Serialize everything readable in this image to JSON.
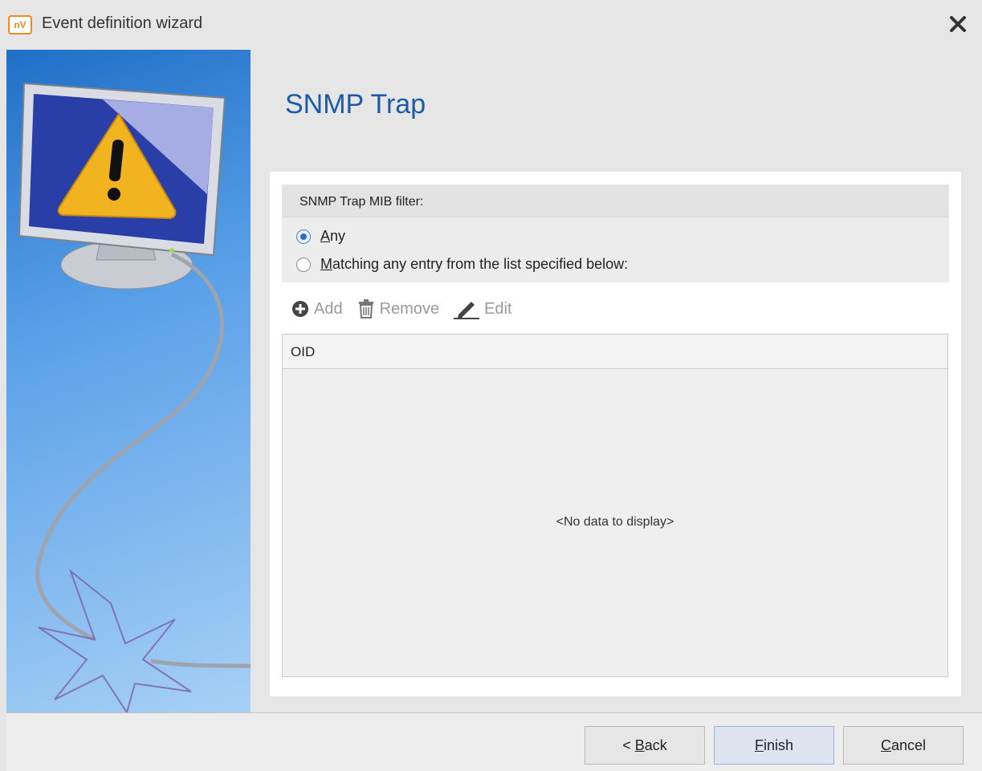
{
  "window": {
    "app_icon_text": "nV",
    "title": "Event definition wizard",
    "close_icon": "close-icon"
  },
  "page": {
    "title": "SNMP Trap"
  },
  "filter": {
    "label": "SNMP Trap MIB filter:",
    "options": [
      {
        "mnemonic": "A",
        "rest": "ny",
        "checked": true
      },
      {
        "mnemonic": "M",
        "rest": "atching any entry from the list specified below:",
        "checked": false
      }
    ]
  },
  "toolbar": {
    "add_label": "Add",
    "remove_label": "Remove",
    "edit_label": "Edit"
  },
  "grid": {
    "columns": [
      "OID"
    ],
    "rows": [],
    "empty_text": "<No data to display>"
  },
  "buttons": {
    "back": {
      "prefix": "< ",
      "mnemonic": "B",
      "rest": "ack"
    },
    "finish": {
      "mnemonic": "F",
      "rest": "inish"
    },
    "cancel": {
      "mnemonic": "C",
      "rest": "ancel"
    }
  },
  "colors": {
    "title_blue": "#1c5aa6",
    "sidebar_top": "#1f6fc7",
    "sidebar_bottom": "#a7d0f5",
    "warning_yellow": "#f2b321",
    "default_button": "#dde4f0"
  }
}
